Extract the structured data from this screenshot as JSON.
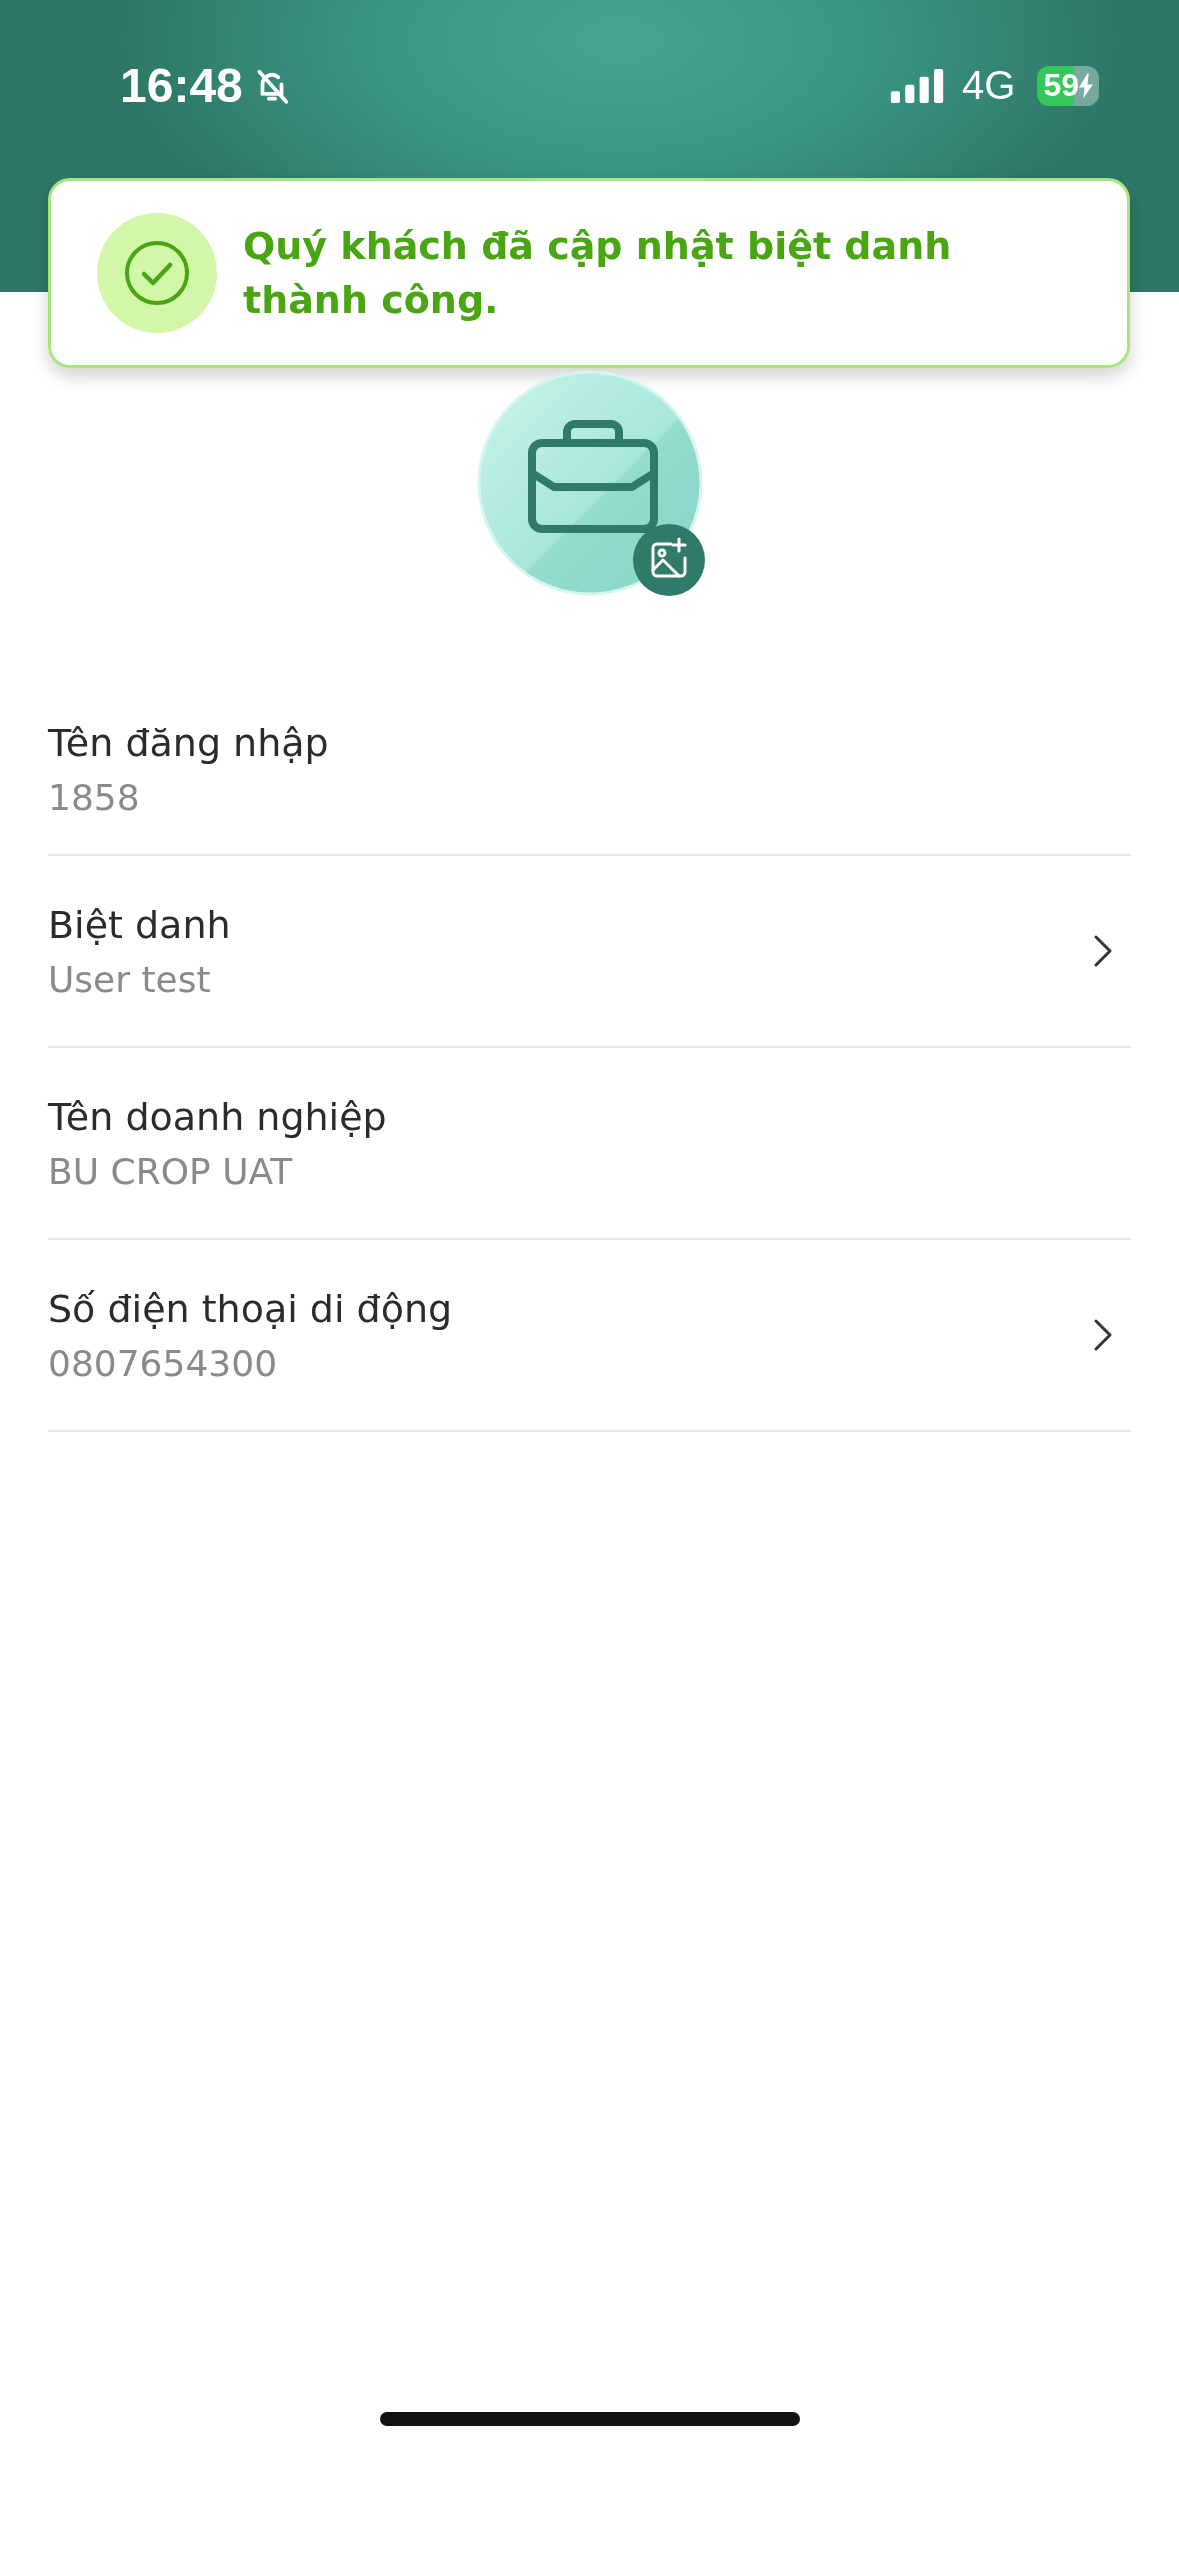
{
  "status_bar": {
    "time": "16:48",
    "silent": true,
    "network": "4G",
    "battery": "59",
    "charging": true
  },
  "toast": {
    "message": "Quý khách đã cập nhật biệt danh thành công."
  },
  "profile_fields": [
    {
      "label": "Tên đăng nhập",
      "value": "1858",
      "chevron": false
    },
    {
      "label": "Biệt danh",
      "value": "User test",
      "chevron": true
    },
    {
      "label": "Tên doanh nghiệp",
      "value": "BU CROP UAT",
      "chevron": false
    },
    {
      "label": "Số điện thoại di động",
      "value": "0807654300",
      "chevron": true
    }
  ]
}
